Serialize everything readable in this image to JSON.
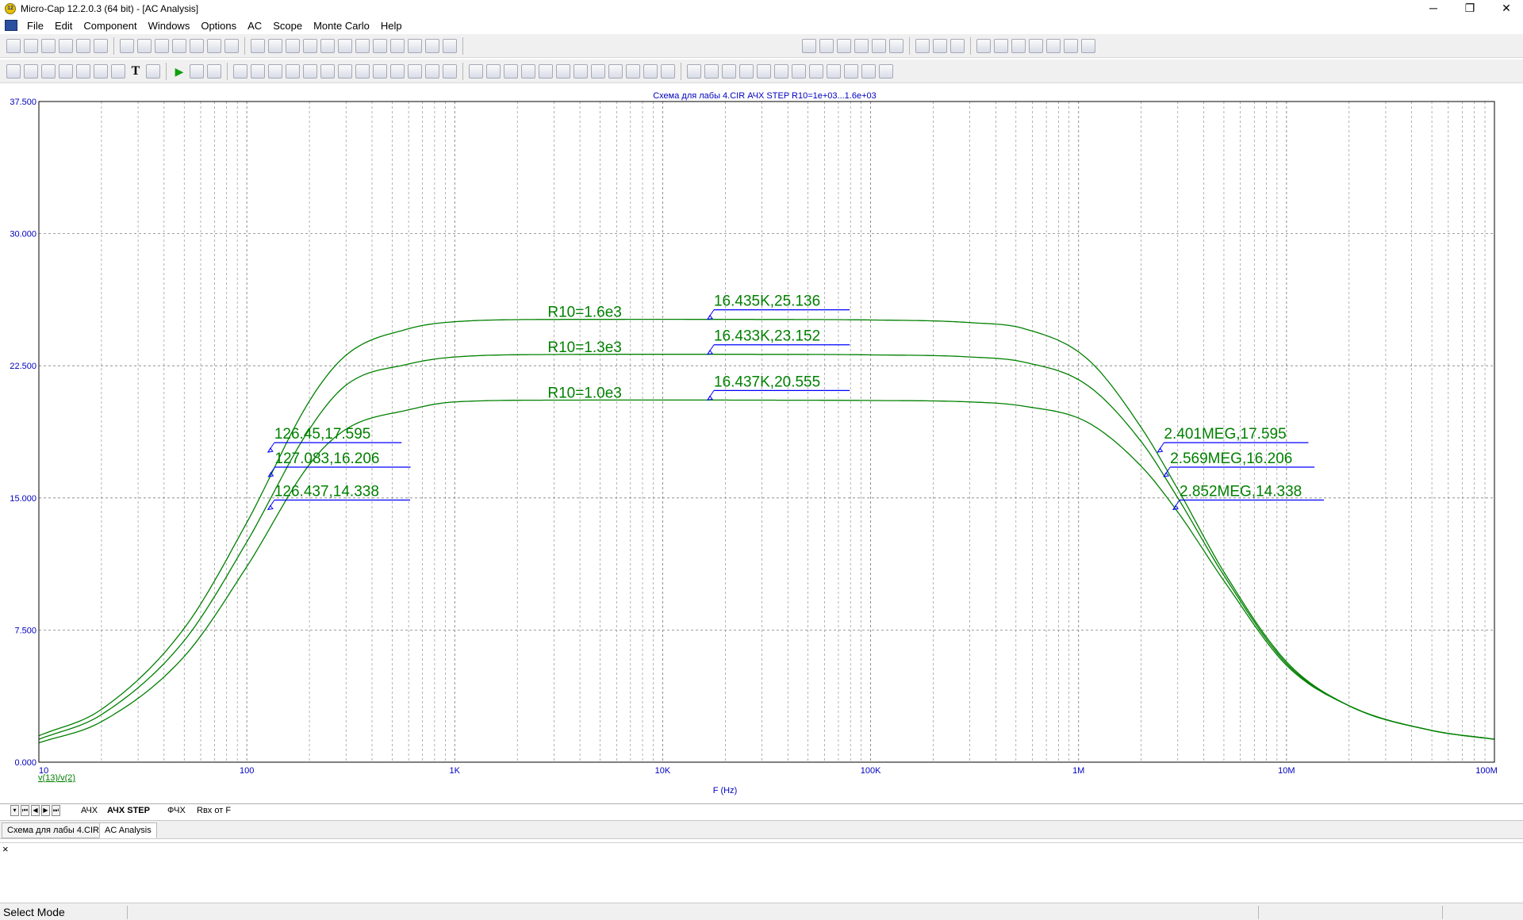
{
  "window": {
    "title": "Micro-Cap 12.2.0.3 (64 bit) - [AC Analysis]",
    "icon": "app-icon"
  },
  "menu": [
    "File",
    "Edit",
    "Component",
    "Windows",
    "Options",
    "AC",
    "Scope",
    "Monte Carlo",
    "Help"
  ],
  "plot_tabs": [
    {
      "label": "АЧХ",
      "active": false
    },
    {
      "label": "АЧХ STEP",
      "active": true
    },
    {
      "label": "ФЧХ",
      "active": false
    },
    {
      "label": "Rвх от F",
      "active": false
    }
  ],
  "doc_tabs": [
    {
      "label": "Схема для лабы 4.CIR",
      "active": false
    },
    {
      "label": "AC Analysis",
      "active": true
    }
  ],
  "status": {
    "text": "Select Mode"
  },
  "colors": {
    "grid": "#808080",
    "curve": "#008000",
    "axis_text": "#0000c0",
    "label_text": "#008000",
    "marker": "#0000ff"
  },
  "chart_data": {
    "type": "line",
    "title": "Схема для лабы 4.CIR АЧХ STEP R10=1e+03...1.6e+03",
    "xlabel": "F (Hz)",
    "series_expression": "v(13)/v(2)",
    "x_scale": "log",
    "xlim": [
      10,
      100000000
    ],
    "ylim": [
      0,
      37.5
    ],
    "x_ticks": [
      {
        "value": 10,
        "label": "10"
      },
      {
        "value": 100,
        "label": "100"
      },
      {
        "value": 1000,
        "label": "1K"
      },
      {
        "value": 10000,
        "label": "10K"
      },
      {
        "value": 100000,
        "label": "100K"
      },
      {
        "value": 1000000,
        "label": "1M"
      },
      {
        "value": 10000000,
        "label": "10M"
      },
      {
        "value": 100000000,
        "label": "100M"
      }
    ],
    "y_ticks": [
      {
        "value": 0,
        "label": "0.000"
      },
      {
        "value": 7.5,
        "label": "7.500"
      },
      {
        "value": 15,
        "label": "15.000"
      },
      {
        "value": 22.5,
        "label": "22.500"
      },
      {
        "value": 30,
        "label": "30.000"
      },
      {
        "value": 37.5,
        "label": "37.500"
      }
    ],
    "grid": true,
    "series": [
      {
        "name": "R10=1.6e3",
        "x": [
          10,
          20,
          50,
          100,
          200,
          300,
          600,
          1000,
          3000,
          10000,
          30000,
          100000,
          300000,
          550000,
          1100000,
          2000000,
          3000000,
          5000000,
          10000000,
          20000000,
          50000000,
          100000000
        ],
        "y": [
          1.5,
          3.0,
          7.6,
          13.6,
          20.5,
          23.1,
          24.6,
          25.0,
          25.13,
          25.136,
          25.13,
          25.1,
          24.95,
          24.6,
          22.9,
          19.0,
          15.5,
          10.8,
          5.7,
          3.2,
          1.8,
          1.3
        ]
      },
      {
        "name": "R10=1.3e3",
        "x": [
          10,
          20,
          50,
          100,
          200,
          300,
          600,
          1000,
          3000,
          10000,
          30000,
          100000,
          300000,
          550000,
          1100000,
          2000000,
          3000000,
          5000000,
          10000000,
          20000000,
          50000000,
          100000000
        ],
        "y": [
          1.3,
          2.7,
          6.9,
          12.5,
          18.9,
          21.4,
          22.6,
          23.0,
          23.14,
          23.152,
          23.15,
          23.12,
          23.0,
          22.7,
          21.4,
          18.2,
          15.0,
          10.6,
          5.6,
          3.2,
          1.8,
          1.3
        ]
      },
      {
        "name": "R10=1.0e3",
        "x": [
          10,
          20,
          50,
          100,
          200,
          300,
          600,
          1000,
          3000,
          10000,
          30000,
          100000,
          300000,
          550000,
          1100000,
          2000000,
          3000000,
          5000000,
          10000000,
          20000000,
          50000000,
          100000000
        ],
        "y": [
          1.1,
          2.3,
          6.0,
          11.1,
          16.9,
          18.9,
          20.0,
          20.45,
          20.55,
          20.555,
          20.55,
          20.53,
          20.45,
          20.2,
          19.3,
          16.8,
          14.2,
          10.3,
          5.5,
          3.2,
          1.8,
          1.3
        ]
      }
    ],
    "curve_labels": [
      {
        "text": "R10=1.6e3",
        "x": 3000,
        "y": 25.14
      },
      {
        "text": "R10=1.3e3",
        "x": 3000,
        "y": 23.15
      },
      {
        "text": "R10=1.0e3",
        "x": 3000,
        "y": 20.55
      }
    ],
    "annotations": [
      {
        "text": "16.435K,25.136",
        "x": 16435,
        "y": 25.136
      },
      {
        "text": "16.433K,23.152",
        "x": 16433,
        "y": 23.152
      },
      {
        "text": "16.437K,20.555",
        "x": 16437,
        "y": 20.555
      },
      {
        "text": "126.45,17.595",
        "x": 126.45,
        "y": 17.595
      },
      {
        "text": "127.083,16.206",
        "x": 127.083,
        "y": 16.206
      },
      {
        "text": "126.437,14.338",
        "x": 126.437,
        "y": 14.338
      },
      {
        "text": "2.401MEG,17.595",
        "x": 2401000,
        "y": 17.595
      },
      {
        "text": "2.569MEG,16.206",
        "x": 2569000,
        "y": 16.206
      },
      {
        "text": "2.852MEG,14.338",
        "x": 2852000,
        "y": 14.338
      }
    ]
  }
}
